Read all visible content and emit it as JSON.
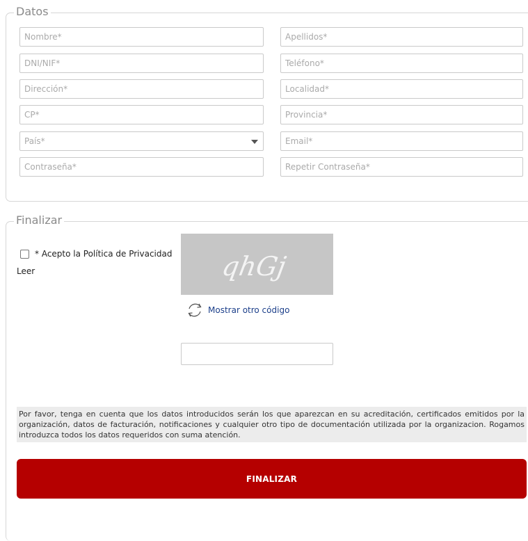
{
  "datos": {
    "legend": "Datos",
    "fields": {
      "nombre": "Nombre*",
      "apellidos": "Apellidos*",
      "dni": "DNI/NIF*",
      "telefono": "Teléfono*",
      "direccion": "Dirección*",
      "localidad": "Localidad*",
      "cp": "CP*",
      "provincia": "Provincia*",
      "pais": "País*",
      "email": "Email*",
      "contrasena": "Contraseña*",
      "repetir_contrasena": "Repetir Contraseña*"
    }
  },
  "finalizar": {
    "legend": "Finalizar",
    "privacy_label": "* Acepto la Política de Privacidad",
    "privacy_checked": false,
    "read_link": "Leer",
    "captcha_text": "qhGj",
    "refresh_label": "Mostrar otro código",
    "captcha_value": "",
    "notice": "Por favor, tenga en cuenta que los datos introducidos serán los que aparezcan en su acreditación, certificados emitidos por la organización, datos de facturación, notificaciones y cualquier otro tipo de documentación utilizada por la organizacion. Rogamos introduzca todos los datos requeridos con suma atención.",
    "submit_label": "FINALIZAR"
  },
  "colors": {
    "accent": "#b50000",
    "link": "#1c3f8a",
    "notice_bg": "#ececec",
    "captcha_bg": "#c6c6c6"
  },
  "icons": {
    "refresh": "refresh-icon",
    "select_caret": "chevron-down-icon"
  }
}
